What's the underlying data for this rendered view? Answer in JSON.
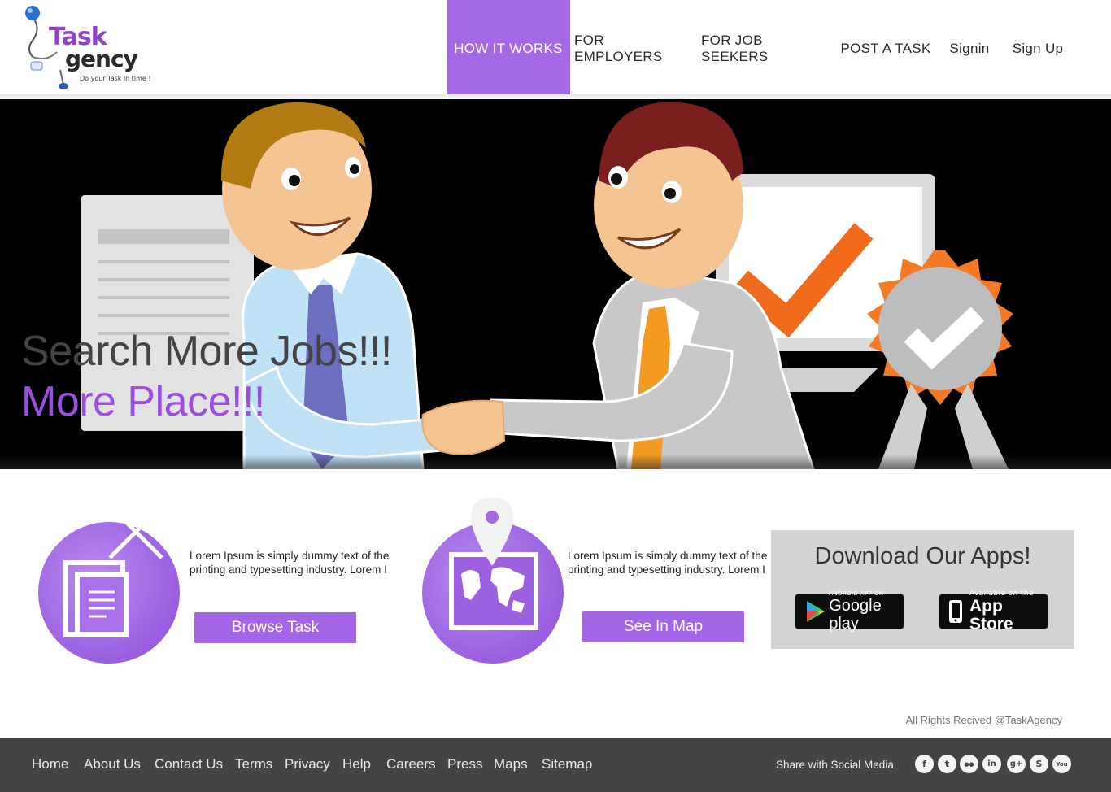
{
  "logo": {
    "text_t": "Task",
    "text_g": "gency",
    "tagline": "Do your Task in time !"
  },
  "nav": {
    "items": [
      {
        "label": "HOW  IT WORKS",
        "active": true
      },
      {
        "label": "FOR EMPLOYERS"
      },
      {
        "label": "FOR JOB SEEKERS"
      },
      {
        "label": "POST A TASK"
      },
      {
        "label": "Signin"
      },
      {
        "label": "Sign Up"
      }
    ]
  },
  "hero": {
    "headline": "Search More Jobs!!!",
    "subheadline": "More Place!!!"
  },
  "features": [
    {
      "icon": "documents-icon",
      "text": "Lorem Ipsum is simply dummy text of the printing and typesetting industry. Lorem I",
      "button": "Browse Task"
    },
    {
      "icon": "map-pin-icon",
      "text": "Lorem Ipsum is simply dummy text of the printing and typesetting industry. Lorem I",
      "button": "See In Map"
    }
  ],
  "apps": {
    "title": "Download Our Apps!",
    "google": {
      "small": "ANDROID APP ON",
      "big": "Google play"
    },
    "apple": {
      "small": "Available on the",
      "big": "App Store"
    }
  },
  "rights": "All Rights Recived @TaskAgency",
  "footer": {
    "links": [
      "Home",
      "About Us",
      "Contact Us",
      "Terms",
      "Privacy",
      "Help",
      "Careers",
      "Press",
      "Maps",
      "Sitemap"
    ],
    "share_label": "Share with Social Media",
    "social": [
      {
        "icon": "facebook-icon",
        "glyph": "f"
      },
      {
        "icon": "twitter-icon",
        "glyph": "t"
      },
      {
        "icon": "flickr-icon",
        "glyph": "●●"
      },
      {
        "icon": "linkedin-icon",
        "glyph": "in"
      },
      {
        "icon": "googleplus-icon",
        "glyph": "g+"
      },
      {
        "icon": "skype-icon",
        "glyph": "S"
      },
      {
        "icon": "youtube-icon",
        "glyph": "You"
      }
    ]
  },
  "colors": {
    "accent": "#a569e6",
    "footer": "#444444",
    "apps_box": "#d4d4d4"
  }
}
